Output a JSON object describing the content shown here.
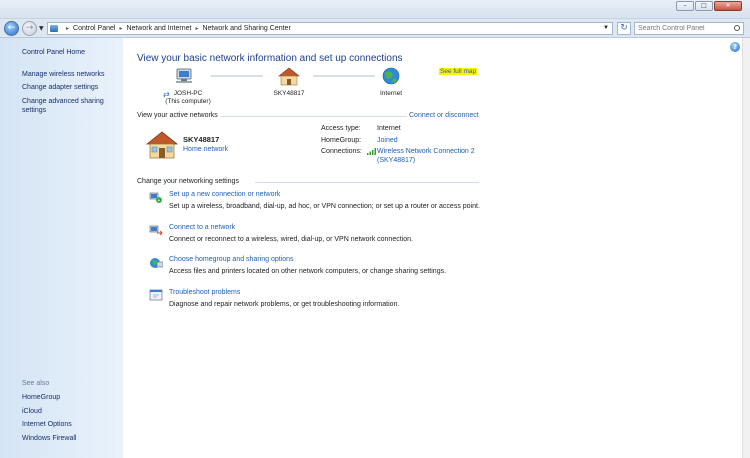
{
  "window": {
    "minimize_glyph": "–",
    "maximize_glyph": "□",
    "close_glyph": "✕"
  },
  "address_bar": {
    "breadcrumbs": [
      "Control Panel",
      "Network and Internet",
      "Network and Sharing Center"
    ],
    "separator": "▸",
    "search_placeholder": "Search Control Panel"
  },
  "sidebar": {
    "home": "Control Panel Home",
    "tasks": [
      "Manage wireless networks",
      "Change adapter settings",
      "Change advanced sharing settings"
    ],
    "see_also_label": "See also",
    "see_also": [
      "HomeGroup",
      "iCloud",
      "Internet Options",
      "Windows Firewall"
    ]
  },
  "main": {
    "title": "View your basic network information and set up connections",
    "see_full_map": "See full map",
    "map": {
      "computer_name": "JOSH-PC",
      "computer_sub": "(This computer)",
      "network_name": "SKY48817",
      "internet": "Internet"
    },
    "active_networks": {
      "header": "View your active networks",
      "connect_link": "Connect or disconnect",
      "network_name": "SKY48817",
      "network_type": "Home network",
      "access_type_label": "Access type:",
      "access_type_value": "Internet",
      "homegroup_label": "HomeGroup:",
      "homegroup_value": "Joined",
      "connections_label": "Connections:",
      "connection_line1": "Wireless Network Connection 2",
      "connection_line2": "(SKY48817)"
    },
    "settings": {
      "header": "Change your networking settings",
      "items": [
        {
          "title": "Set up a new connection or network",
          "desc": "Set up a wireless, broadband, dial-up, ad hoc, or VPN connection; or set up a router or access point."
        },
        {
          "title": "Connect to a network",
          "desc": "Connect or reconnect to a wireless, wired, dial-up, or VPN network connection."
        },
        {
          "title": "Choose homegroup and sharing options",
          "desc": "Access files and printers located on other network computers, or change sharing settings."
        },
        {
          "title": "Troubleshoot problems",
          "desc": "Diagnose and repair network problems, or get troubleshooting information."
        }
      ]
    }
  },
  "colors": {
    "link": "#1f5fb6",
    "title": "#1e3f8a",
    "highlight": "#fff200",
    "sidebar_bg": "#dce9f7"
  }
}
